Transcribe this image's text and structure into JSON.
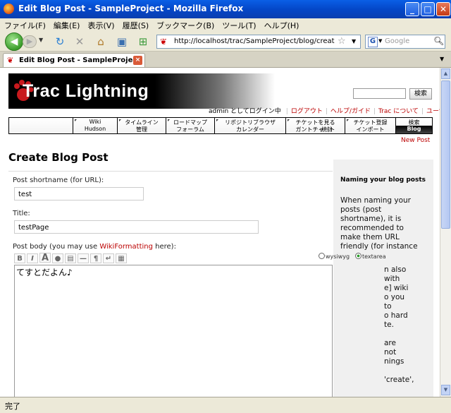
{
  "window": {
    "title": "Edit Blog Post - SampleProject - Mozilla Firefox"
  },
  "menu": [
    "ファイル(F)",
    "編集(E)",
    "表示(V)",
    "履歴(S)",
    "ブックマーク(B)",
    "ツール(T)",
    "ヘルプ(H)"
  ],
  "nav": {
    "url": "http://localhost/trac/SampleProject/blog/create?name=",
    "search_placeholder": "Google"
  },
  "tab": {
    "label": "Edit Blog Post - SampleProject"
  },
  "status": "完了",
  "trac": {
    "logo": "Trac Lightning",
    "search_button": "検索",
    "metanav": {
      "user": "admin としてログイン中",
      "links": [
        "ログアウト",
        "ヘルプ/ガイド",
        "Trac について",
        "ユーザ設定"
      ]
    },
    "mainnav": [
      {
        "l1": "",
        "l2": ""
      },
      {
        "l1": "Wiki",
        "l2": "Hudson"
      },
      {
        "l1": "タイムライン",
        "l2": "管理"
      },
      {
        "l1": "ロードマップ",
        "l2": "フォーラム"
      },
      {
        "l1": "リポジトリブラウザ",
        "l2": "カレンダー"
      },
      {
        "l1": "チケットを見る",
        "l2": "ガントチャート"
      },
      {
        "l1": "",
        "l2": "統計"
      },
      {
        "l1": "チケット登録",
        "l2": "インポート"
      },
      {
        "l1": "検索",
        "l2": "Blog"
      }
    ],
    "newpost": "New Post",
    "page_title": "Create Blog Post",
    "form": {
      "shortname_label": "Post shortname (for URL):",
      "shortname_value": "test",
      "title_label": "Title:",
      "title_value": "testPage",
      "body_label_pre": "Post body (you may use ",
      "body_label_link": "WikiFormatting",
      "body_label_post": " here):",
      "body_value": "てすとだよん♪",
      "toolbar": [
        "B",
        "I",
        "A",
        "●",
        "▤",
        "—",
        "¶",
        "↵",
        "▦"
      ],
      "mode_wysiwyg": "wysiwyg",
      "mode_textarea": "textarea"
    },
    "sidebar": {
      "heading": "Naming your blog posts",
      "lines": [
        "When naming your",
        "posts (post",
        "shortname), it is",
        "recommended to",
        "make them URL",
        "friendly (for instance"
      ],
      "lines_tail": [
        "n also",
        "with",
        "e] wiki",
        "o you",
        "to",
        "o hard",
        "te.",
        "",
        "are",
        "not",
        "nings",
        "",
        "'create',"
      ]
    }
  }
}
